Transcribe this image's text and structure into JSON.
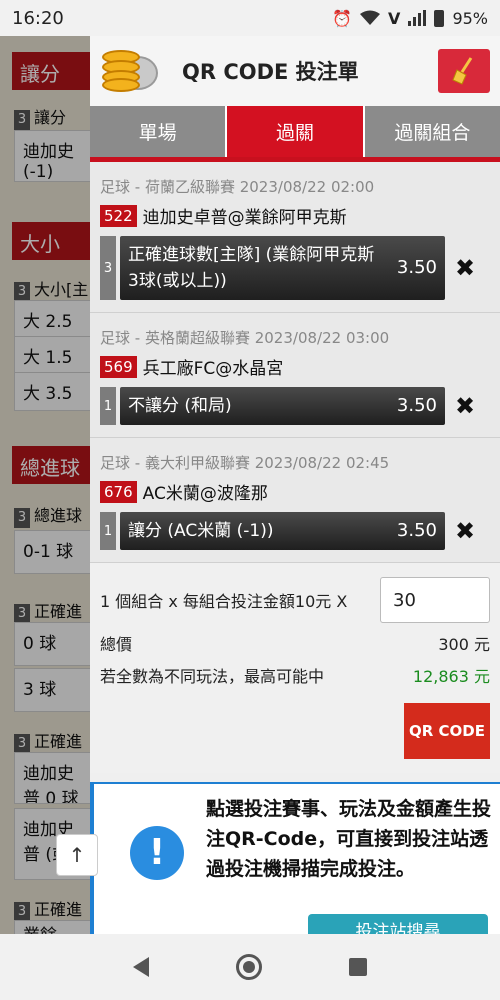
{
  "status_bar": {
    "time": "16:20",
    "battery": "95%"
  },
  "background": {
    "sections": [
      {
        "title": "讓分",
        "rows": [
          "讓分"
        ],
        "boxes": [
          "迪加史 (-1)"
        ]
      },
      {
        "title": "大小",
        "rows": [
          "大小[主"
        ],
        "boxes": [
          "大 2.5",
          "大 1.5",
          "大 3.5"
        ]
      },
      {
        "title": "總進球",
        "rows": [
          "總進球"
        ],
        "boxes": [
          "0-1 球"
        ]
      },
      {
        "title": "",
        "rows": [
          "正確進"
        ],
        "boxes": [
          "0 球",
          "3 球"
        ]
      },
      {
        "title": "",
        "rows": [
          "正確進"
        ],
        "boxes": [
          "迪加史 普 0 球",
          "迪加史 普 (或"
        ]
      },
      {
        "title": "",
        "rows": [
          "正確進"
        ],
        "boxes": [
          "業餘"
        ]
      }
    ],
    "row_num": "3",
    "scroll_top": "↑"
  },
  "panel": {
    "title": "QR CODE 投注單",
    "tabs": [
      {
        "label": "單場",
        "active": false
      },
      {
        "label": "過關",
        "active": true
      },
      {
        "label": "過關組合",
        "active": false
      }
    ],
    "matches": [
      {
        "league": "足球 - 荷蘭乙級聯賽 2023/08/22 02:00",
        "code": "522",
        "teams": "迪加史卓普@業餘阿甲克斯",
        "bet_num": "3",
        "bet": "正確進球數[主隊] (業餘阿甲克斯 3球(或以上))",
        "odds": "3.50"
      },
      {
        "league": "足球 - 英格蘭超級聯賽 2023/08/22 03:00",
        "code": "569",
        "teams": "兵工廠FC@水晶宮",
        "bet_num": "1",
        "bet": "不讓分 (和局)",
        "odds": "3.50"
      },
      {
        "league": "足球 - 義大利甲級聯賽 2023/08/22 02:45",
        "code": "676",
        "teams": "AC米蘭@波隆那",
        "bet_num": "1",
        "bet": "讓分 (AC米蘭 (-1))",
        "odds": "3.50"
      }
    ],
    "remove_icon": "✖",
    "combo_text": "1 個組合 x 每組合投注金額10元 X",
    "amount_value": "30",
    "total_label": "總價",
    "total_value": "300 元",
    "max_label": "若全數為不同玩法，最高可能中",
    "max_value": "12,863 元",
    "qr_button": "QR CODE",
    "info_text": "點選投注賽事、玩法及金額產生投注QR-Code，可直接到投注站透過投注機掃描完成投注。",
    "info_button": "投注站搜尋"
  },
  "colors": {
    "accent_red": "#d31121",
    "green": "#1b8c1f",
    "info_blue": "#2a8de0"
  }
}
